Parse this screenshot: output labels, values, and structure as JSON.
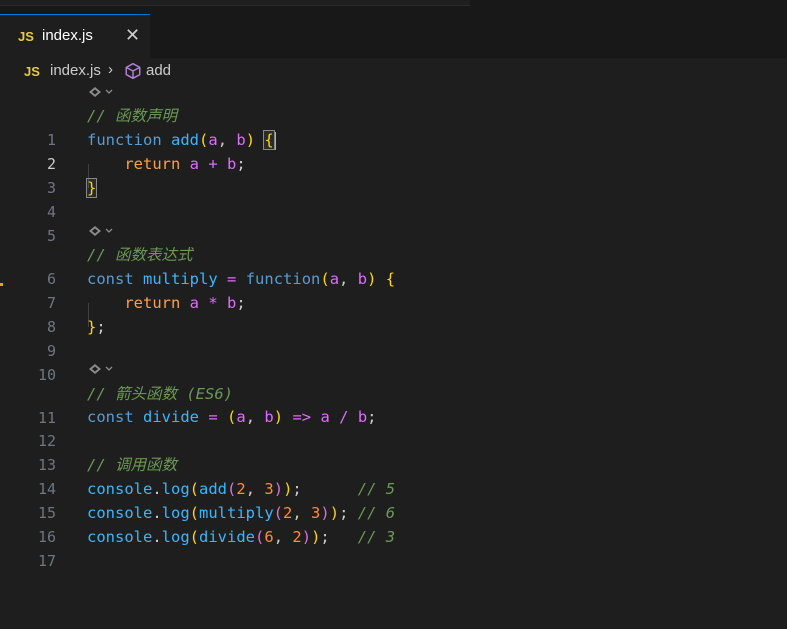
{
  "tab": {
    "icon": "JS",
    "filename": "index.js",
    "close": "✕"
  },
  "breadcrumb": {
    "icon": "JS",
    "file": "index.js",
    "separator": "›",
    "symbol": "add"
  },
  "lines": {
    "l1": {
      "num": "1",
      "comment": "// 函数声明"
    },
    "l2": {
      "num": "2",
      "kw": "function",
      "name": "add",
      "open": "(",
      "a": "a",
      "comma": ", ",
      "b": "b",
      "close": ")",
      "sp": " ",
      "brace": "{"
    },
    "l3": {
      "num": "3",
      "indent": "    ",
      "ret": "return",
      "a": "a",
      "op": "+",
      "b": "b",
      "semi": ";"
    },
    "l4": {
      "num": "4",
      "brace": "}"
    },
    "l5": {
      "num": "5"
    },
    "l6": {
      "num": "6",
      "comment": "// 函数表达式"
    },
    "l7": {
      "num": "7",
      "kw": "const",
      "name": "multiply",
      "eq": "=",
      "fkw": "function",
      "open": "(",
      "a": "a",
      "comma": ", ",
      "b": "b",
      "close": ")",
      "brace": "{"
    },
    "l8": {
      "num": "8",
      "indent": "    ",
      "ret": "return",
      "a": "a",
      "op": "*",
      "b": "b",
      "semi": ";"
    },
    "l9": {
      "num": "9",
      "brace": "}",
      "semi": ";"
    },
    "l10": {
      "num": "10"
    },
    "l11": {
      "num": "11",
      "comment": "// 箭头函数 (ES6)"
    },
    "l12": {
      "num": "12",
      "kw": "const",
      "name": "divide",
      "eq": "=",
      "open": "(",
      "a": "a",
      "comma": ", ",
      "b": "b",
      "close": ")",
      "arrow": "=>",
      "a2": "a",
      "op": "/",
      "b2": "b",
      "semi": ";"
    },
    "l13": {
      "num": "13"
    },
    "l14": {
      "num": "14",
      "comment": "// 调用函数"
    },
    "l15": {
      "num": "15",
      "obj": "console",
      "dot": ".",
      "method": "log",
      "o1": "(",
      "fn": "add",
      "o2": "(",
      "n1": "2",
      "comma": ", ",
      "n2": "3",
      "c2": ")",
      "c1": ")",
      "semi": ";",
      "pad": "      ",
      "comment": "// 5"
    },
    "l16": {
      "num": "16",
      "obj": "console",
      "dot": ".",
      "method": "log",
      "o1": "(",
      "fn": "multiply",
      "o2": "(",
      "n1": "2",
      "comma": ", ",
      "n2": "3",
      "c2": ")",
      "c1": ")",
      "semi": ";",
      "pad": " ",
      "comment": "// 6"
    },
    "l17": {
      "num": "17",
      "obj": "console",
      "dot": ".",
      "method": "log",
      "o1": "(",
      "fn": "divide",
      "o2": "(",
      "n1": "6",
      "comma": ", ",
      "n2": "2",
      "c2": ")",
      "c1": ")",
      "semi": ";",
      "pad": "   ",
      "comment": "// 3"
    }
  },
  "colors": {
    "editor_bg": "#1e1e1e",
    "keyword": "#569cd6",
    "function_name": "#3ab6ff",
    "parameter": "#e06bff",
    "number": "#ff8c3a",
    "comment": "#6a9955",
    "bracket_level1": "#ffd700",
    "bracket_level2": "#da70d6",
    "bracket_level3": "#179fff",
    "js_icon": "#e8c93f"
  },
  "icons": {
    "codelens": "codelens-icon",
    "symbol": "symbol-method-icon",
    "close": "close-icon"
  }
}
